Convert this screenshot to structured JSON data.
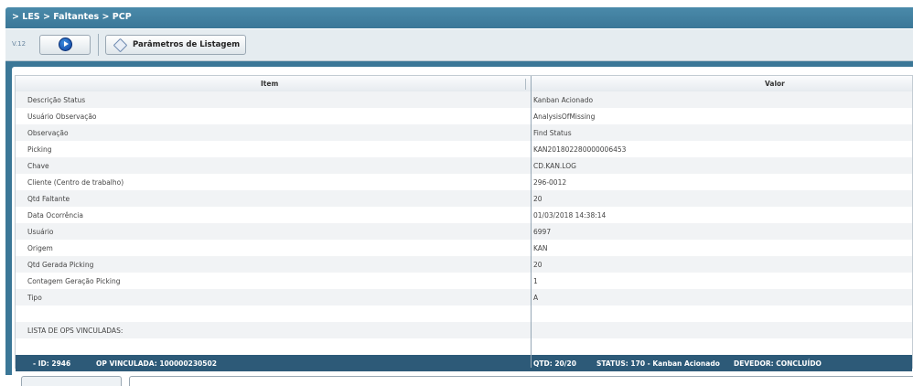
{
  "breadcrumb": "> LES > Faltantes > PCP",
  "toolbar": {
    "version": "V.12",
    "params_label": "Parâmetros de Listagem"
  },
  "grid": {
    "col_item": "Item",
    "col_valor": "Valor",
    "rows": [
      {
        "item": "Descrição Status",
        "valor": "Kanban Acionado"
      },
      {
        "item": "Usuário Observação",
        "valor": "AnalysisOfMissing"
      },
      {
        "item": "Observação",
        "valor": "Find Status"
      },
      {
        "item": "Picking",
        "valor": "KAN201802280000006453"
      },
      {
        "item": "Chave",
        "valor": "CD.KAN.LOG"
      },
      {
        "item": "Cliente (Centro de trabalho)",
        "valor": "296-0012"
      },
      {
        "item": "Qtd Faltante",
        "valor": "20"
      },
      {
        "item": "Data Ocorrência",
        "valor": "01/03/2018 14:38:14"
      },
      {
        "item": "Usuário",
        "valor": "6997"
      },
      {
        "item": "Origem",
        "valor": "KAN"
      },
      {
        "item": "Qtd Gerada Picking",
        "valor": "20"
      },
      {
        "item": "Contagem Geração Picking",
        "valor": "1"
      },
      {
        "item": "Tipo",
        "valor": "A"
      },
      {
        "item": "",
        "valor": ""
      },
      {
        "item": "LISTA DE OPS VINCULADAS:",
        "valor": ""
      }
    ],
    "op": {
      "id": "- ID: 2946",
      "vinculada": "OP VINCULADA: 100000230502",
      "qtd": "QTD: 20/20",
      "status": "STATUS: 170 - Kanban Acionado",
      "devedor": "DEVEDOR: CONCLUÍDO"
    }
  }
}
